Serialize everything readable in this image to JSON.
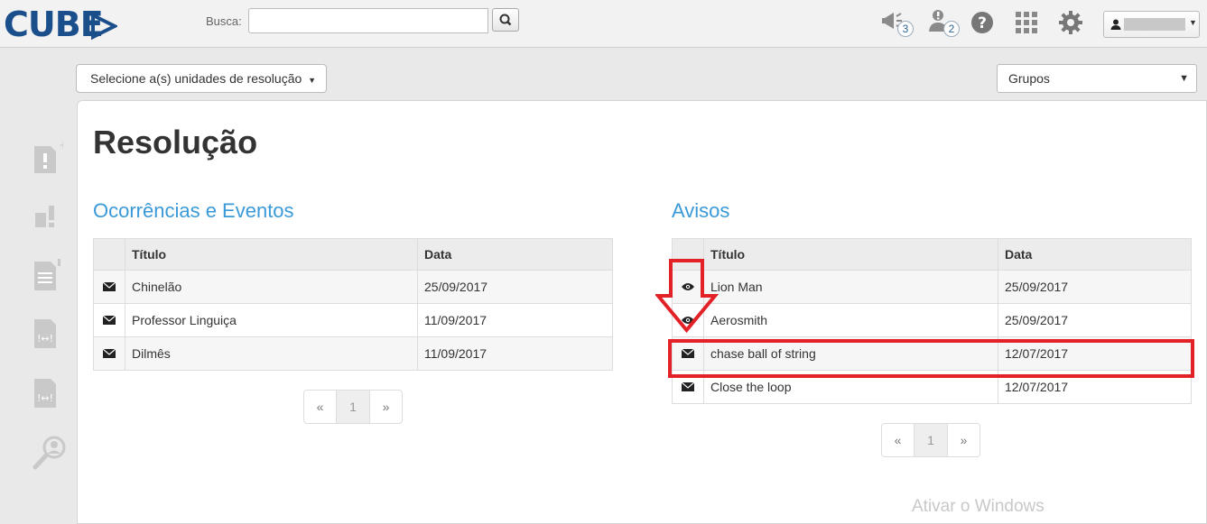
{
  "brand": {
    "logo_text": "CUBE"
  },
  "search": {
    "label": "Busca:",
    "value": "",
    "placeholder": ""
  },
  "nav": {
    "announcements_count": "3",
    "alerts_count": "2"
  },
  "toolbar": {
    "units_button_label": "Selecione a(s) unidades de resolução",
    "groups_select_value": "Grupos"
  },
  "page": {
    "title": "Resolução"
  },
  "occurrences": {
    "title": "Ocorrências e Eventos",
    "columns": [
      "Título",
      "Data"
    ],
    "rows": [
      {
        "icon": "envelope-icon",
        "title": "Chinelão",
        "date": "25/09/2017"
      },
      {
        "icon": "envelope-icon",
        "title": "Professor Linguiça",
        "date": "11/09/2017"
      },
      {
        "icon": "envelope-icon",
        "title": "Dilmês",
        "date": "11/09/2017"
      }
    ],
    "pagination": {
      "prev": "«",
      "current": "1",
      "next": "»"
    }
  },
  "notices": {
    "title": "Avisos",
    "columns": [
      "Título",
      "Data"
    ],
    "rows": [
      {
        "icon": "eye-icon",
        "title": "Lion Man",
        "date": "25/09/2017"
      },
      {
        "icon": "eye-icon",
        "title": "Aerosmith",
        "date": "25/09/2017"
      },
      {
        "icon": "envelope-icon",
        "title": "chase ball of string",
        "date": "12/07/2017"
      },
      {
        "icon": "envelope-icon",
        "title": "Close the loop",
        "date": "12/07/2017"
      }
    ],
    "pagination": {
      "prev": "«",
      "current": "1",
      "next": "»"
    }
  },
  "watermark": "Ativar o Windows",
  "colors": {
    "brand": "#1a4f8c",
    "section_title": "#3a9ad9",
    "annotation": "#e32227"
  }
}
